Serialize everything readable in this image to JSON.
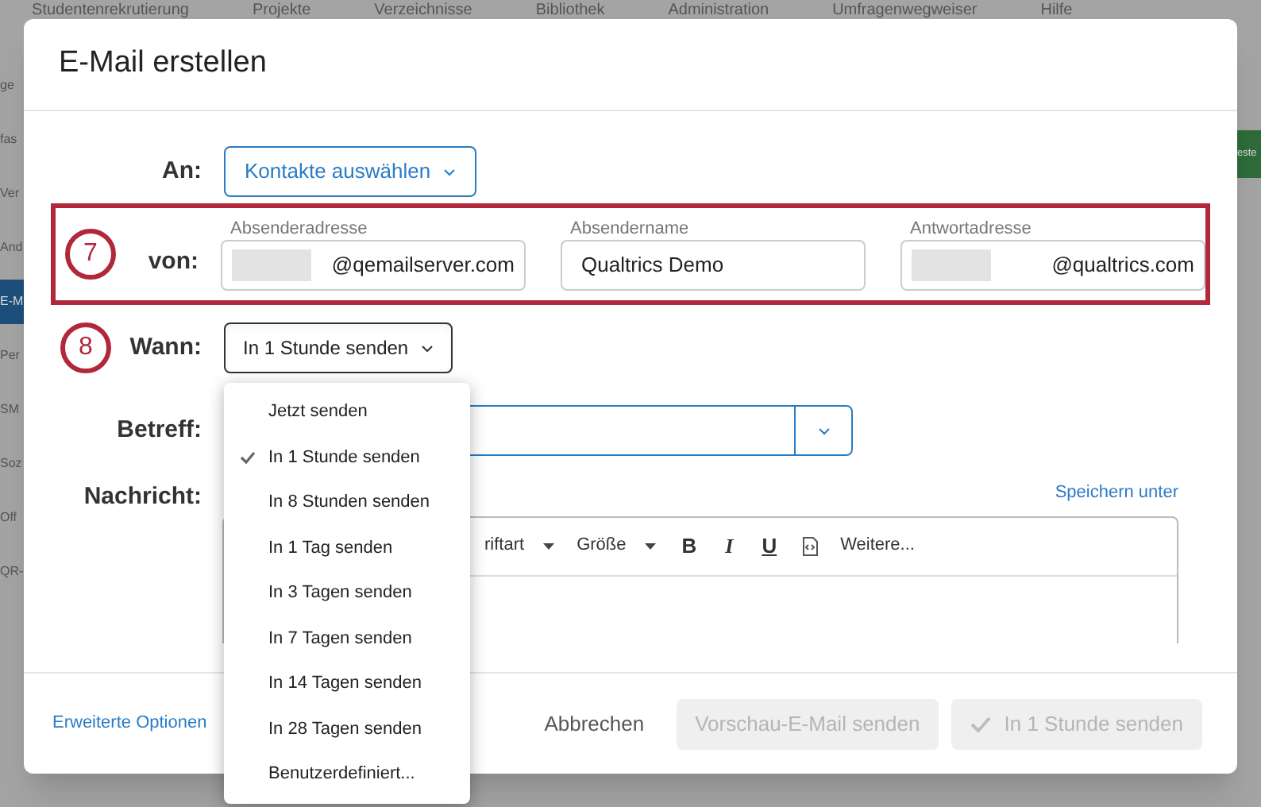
{
  "background": {
    "nav": [
      "Studentenrekrutierung",
      "Projekte",
      "Verzeichnisse",
      "Bibliothek",
      "Administration",
      "Umfragenwegweiser",
      "Hilfe"
    ],
    "sidebar": [
      {
        "label": "ge",
        "selected": false
      },
      {
        "label": "fas",
        "selected": false
      },
      {
        "label": "Ver",
        "selected": false
      },
      {
        "label": "And",
        "selected": false
      },
      {
        "label": "E-M",
        "selected": true
      },
      {
        "label": "Per",
        "selected": false
      },
      {
        "label": "SM",
        "selected": false
      },
      {
        "label": "Soz",
        "selected": false
      },
      {
        "label": "Off",
        "selected": false
      },
      {
        "label": "QR-",
        "selected": false
      }
    ],
    "action_button": "este"
  },
  "dialog": {
    "title": "E-Mail erstellen",
    "to": {
      "label": "An:",
      "button": "Kontakte auswählen"
    },
    "from": {
      "marker": "7",
      "label": "von:",
      "fields": [
        {
          "label": "Absenderadresse",
          "value": "@qemailserver.com",
          "redacted": true
        },
        {
          "label": "Absendername",
          "value": "Qualtrics Demo",
          "redacted": false
        },
        {
          "label": "Antwortadresse",
          "value": "@qualtrics.com",
          "redacted": true
        }
      ]
    },
    "when": {
      "marker": "8",
      "label": "Wann:",
      "value": "In 1 Stunde senden",
      "expanded": true,
      "options": [
        {
          "label": "Jetzt senden",
          "selected": false
        },
        {
          "label": "In 1 Stunde senden",
          "selected": true
        },
        {
          "label": "In 8 Stunden senden",
          "selected": false
        },
        {
          "label": "In 1 Tag senden",
          "selected": false
        },
        {
          "label": "In 3 Tagen senden",
          "selected": false
        },
        {
          "label": "In 7 Tagen senden",
          "selected": false
        },
        {
          "label": "In 14 Tagen senden",
          "selected": false
        },
        {
          "label": "In 28 Tagen senden",
          "selected": false
        },
        {
          "label": "Benutzerdefiniert...",
          "selected": false
        }
      ]
    },
    "subject": {
      "label": "Betreff:"
    },
    "message": {
      "label": "Nachricht:",
      "save_link": "Speichern unter",
      "toolbar": [
        {
          "kind": "dropdown",
          "label": "riftart"
        },
        {
          "kind": "dropdown",
          "label": "Größe"
        },
        {
          "kind": "bold",
          "label": "B"
        },
        {
          "kind": "italic",
          "label": "I"
        },
        {
          "kind": "underline",
          "label": "U"
        },
        {
          "kind": "source"
        },
        {
          "kind": "text",
          "label": "Weitere..."
        }
      ]
    },
    "footer": {
      "advanced_link": "Erweiterte Optionen",
      "cancel": "Abbrechen",
      "preview": "Vorschau-E-Mail senden",
      "send": "In 1 Stunde senden"
    }
  }
}
